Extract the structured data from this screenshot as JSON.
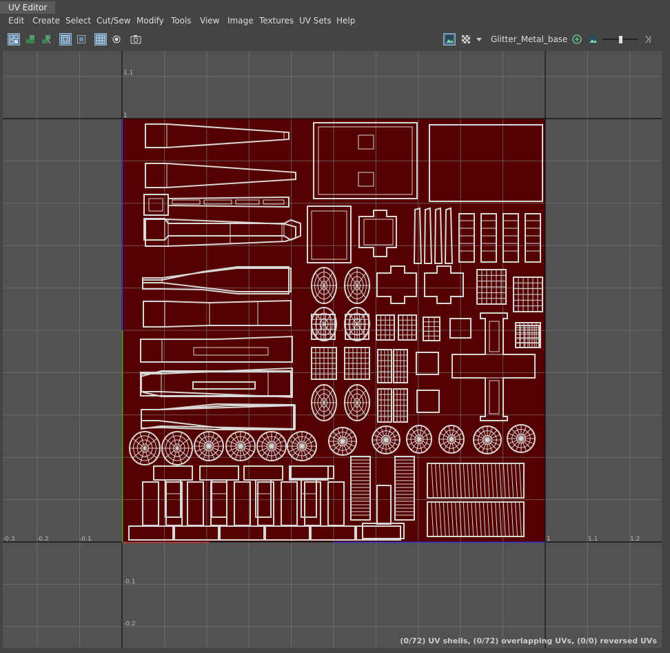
{
  "window": {
    "title": "UV Editor"
  },
  "menu": [
    "Edit",
    "Create",
    "Select",
    "Cut/Sew",
    "Modify",
    "Tools",
    "View",
    "Image",
    "Textures",
    "UV Sets",
    "Help"
  ],
  "toolbar": {
    "left_icons": [
      "uv-shell-icon",
      "uv-vertex-icon",
      "uv-edge-icon",
      "uv-face-icon",
      "uv-select-icon",
      "grid-icon",
      "isolate-icon",
      "snapshot-icon"
    ],
    "right_icons": [
      "image-display-icon",
      "checker-icon",
      "dropdown-arrow-icon"
    ],
    "texture_name": "Glitter_Metal_basecolor",
    "exposure_slider_value": 0.5
  },
  "viewport": {
    "texture_color": "#550000",
    "wire_color": "#d8d8d8",
    "grid": true,
    "u_labels": [
      "-0.3",
      "-0.2",
      "-0.1",
      "1",
      "1.1",
      "1.2"
    ],
    "v_labels": [
      "1.1",
      "1",
      "-0.1",
      "-0.2"
    ]
  },
  "status": "(0/72) UV shells, (0/72) overlapping UVs, (0/0) reversed UVs"
}
